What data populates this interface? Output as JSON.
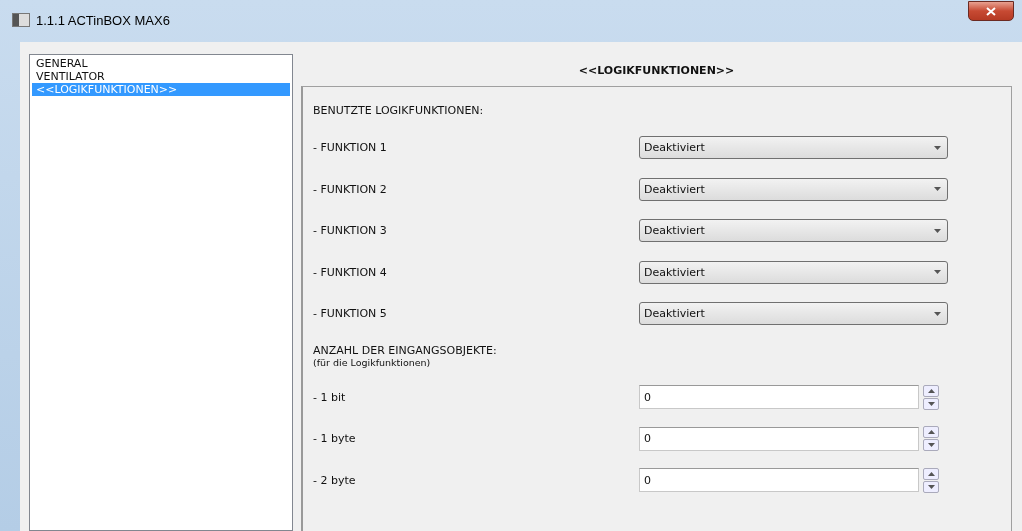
{
  "window": {
    "title": "1.1.1 ACTinBOX MAX6"
  },
  "sidebar": {
    "items": [
      {
        "label": "GENERAL",
        "selected": false
      },
      {
        "label": "VENTILATOR",
        "selected": false
      },
      {
        "label": "<<LOGIKFUNKTIONEN>>",
        "selected": true
      }
    ]
  },
  "panel": {
    "title": "<<LOGIKFUNKTIONEN>>",
    "rows": [
      {
        "kind": "heading",
        "label": "BENUTZTE LOGIKFUNKTIONEN:"
      },
      {
        "kind": "dropdown",
        "label": "- FUNKTION 1",
        "value": "Deaktiviert"
      },
      {
        "kind": "dropdown",
        "label": "- FUNKTION 2",
        "value": "Deaktiviert"
      },
      {
        "kind": "dropdown",
        "label": "- FUNKTION 3",
        "value": "Deaktiviert"
      },
      {
        "kind": "dropdown",
        "label": "- FUNKTION 4",
        "value": "Deaktiviert"
      },
      {
        "kind": "dropdown",
        "label": "- FUNKTION 5",
        "value": "Deaktiviert"
      },
      {
        "kind": "heading",
        "label": "ANZAHL DER EINGANGSOBJEKTE:",
        "note": "(für die Logikfunktionen)"
      },
      {
        "kind": "spin",
        "label": "- 1 bit",
        "value": "0"
      },
      {
        "kind": "spin",
        "label": "- 1 byte",
        "value": "0"
      },
      {
        "kind": "spin",
        "label": "- 2 byte",
        "value": "0"
      }
    ]
  }
}
